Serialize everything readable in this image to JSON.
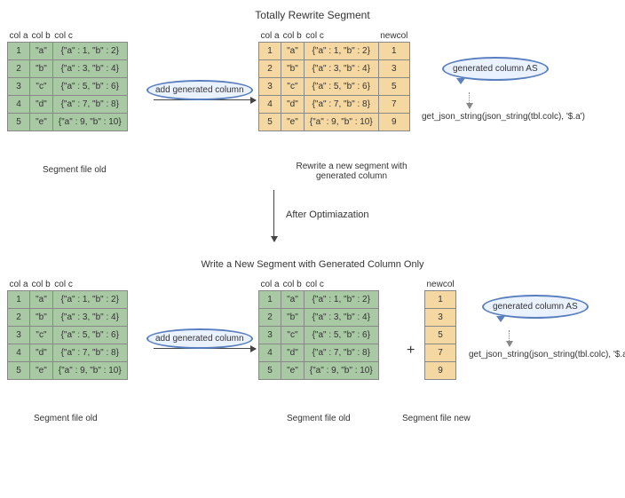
{
  "titles": {
    "top": "Totally Rewrite Segment",
    "between": "After Optimiazation",
    "bottom": "Write a New Segment with Generated Column Only"
  },
  "headers": {
    "a": "col a",
    "b": "col b",
    "c": "col c",
    "new": "newcol"
  },
  "rows": [
    {
      "a": "1",
      "b": "\"a\"",
      "c": "{\"a\" : 1, \"b\" : 2}",
      "n": "1"
    },
    {
      "a": "2",
      "b": "\"b\"",
      "c": "{\"a\" : 3, \"b\" : 4}",
      "n": "3"
    },
    {
      "a": "3",
      "b": "\"c\"",
      "c": "{\"a\" : 5, \"b\" : 6}",
      "n": "5"
    },
    {
      "a": "4",
      "b": "\"d\"",
      "c": "{\"a\" : 7, \"b\" : 8}",
      "n": "7"
    },
    {
      "a": "5",
      "b": "\"e\"",
      "c": "{\"a\" : 9, \"b\" : 10}",
      "n": "9"
    }
  ],
  "labels": {
    "pill": "add generated column",
    "bubble": "generated column AS",
    "expr": "get_json_string(json_string(tbl.colc), '$.a')",
    "seg_old": "Segment file old",
    "seg_new": "Segment file new",
    "rewrite": "Rewrite a new segment with generated column",
    "plus": "+"
  }
}
